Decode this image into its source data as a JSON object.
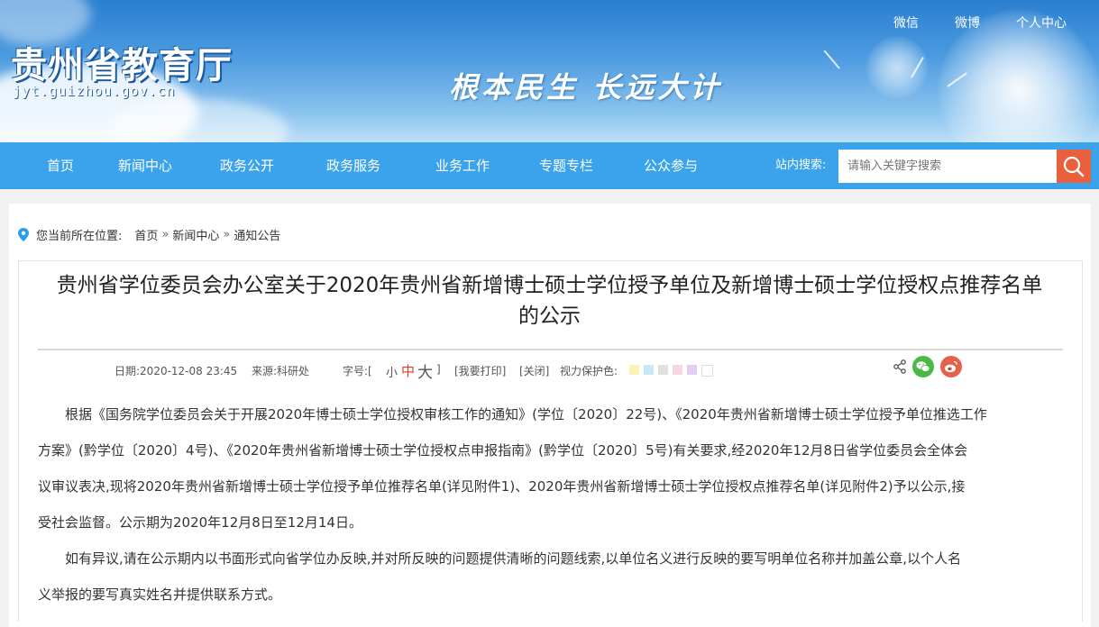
{
  "header": {
    "site_title": "贵州省教育厅",
    "site_domain": "jyt.guizhou.gov.cn",
    "slogan": "根本民生 长远大计",
    "top_links": [
      "微信",
      "微博",
      "个人中心"
    ]
  },
  "nav": {
    "items": [
      "首页",
      "新闻中心",
      "政务公开",
      "政务服务",
      "业务工作",
      "专题专栏",
      "公众参与"
    ],
    "search_label": "站内搜索:",
    "search_placeholder": "请输入关键字搜索"
  },
  "breadcrumb": {
    "prefix": "您当前所在位置:",
    "items": [
      "首页",
      "新闻中心",
      "通知公告"
    ],
    "separator": "»"
  },
  "article": {
    "title_line1": "贵州省学位委员会办公室关于2020年贵州省新增博士硕士学位授予单位及新增博士硕士学位授权点推荐名单",
    "title_line2": "的公示",
    "date": "日期:2020-12-08 23:45",
    "source": "来源:科研处",
    "font_size_label": "字号:[",
    "font_small": "小",
    "font_medium": "中",
    "font_large": "大",
    "font_close": "]",
    "print": "[我要打印]",
    "close": "[关闭]",
    "eye_protect": "视力保护色:",
    "swatch_colors": [
      "#f9f3b4",
      "#c7e8f7",
      "#e0e0e0",
      "#f7d6df",
      "#e3cdf2",
      "#ffffff"
    ],
    "para1_l1": "根据《国务院学位委员会关于开展2020年博士硕士学位授权审核工作的通知》(学位〔2020〕22号)、《2020年贵州省新增博士硕士学位授予单位推选工作",
    "para1_l2": "方案》(黔学位〔2020〕4号)、《2020年贵州省新增博士硕士学位授权点申报指南》(黔学位〔2020〕5号)有关要求,经2020年12月8日省学位委员会全体会",
    "para1_l3": "议审议表决,现将2020年贵州省新增博士硕士学位授予单位推荐名单(详见附件1)、2020年贵州省新增博士硕士学位授权点推荐名单(详见附件2)予以公示,接",
    "para1_l4": "受社会监督。公示期为2020年12月8日至12月14日。",
    "para2_l1": "如有异议,请在公示期内以书面形式向省学位办反映,并对所反映的问题提供清晰的问题线索,以单位名义进行反映的要写明单位名称并加盖公章,以个人名",
    "para2_l2": "义举报的要写真实姓名并提供联系方式。"
  },
  "colors": {
    "nav_bg": "#3aa3ec",
    "search_button": "#e8603c",
    "font_medium_accent": "#e23b2a"
  }
}
